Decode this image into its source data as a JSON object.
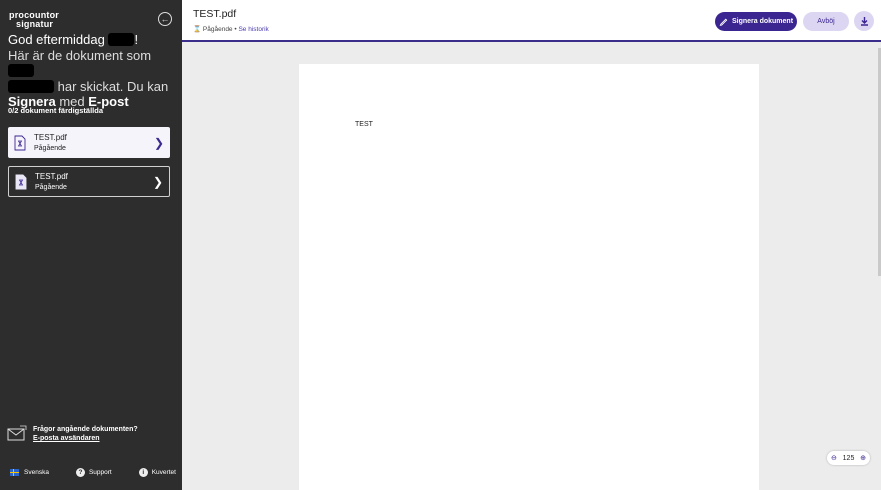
{
  "sidebar": {
    "logo_line1": "procountor",
    "logo_line2": "signatur",
    "greeting_prefix": "God eftermiddag",
    "greeting_end": "!",
    "intro_part1": "Här är de dokument som",
    "intro_part2": "har skickat. Du kan",
    "sign_word": "Signera",
    "with_word": "med",
    "method": "E-post",
    "progress": "0/2 dokument färdigställda",
    "documents": [
      {
        "name": "TEST.pdf",
        "status": "Pågående"
      },
      {
        "name": "TEST.pdf",
        "status": "Pågående"
      }
    ],
    "help_question": "Frågor angående dokumenten?",
    "help_link": "E-posta avsändaren",
    "footer": {
      "language": "Svenska",
      "support": "Support",
      "envelope": "Kuvertet"
    }
  },
  "header": {
    "title": "TEST.pdf",
    "status": "Pågående",
    "separator": "•",
    "history_link": "Se historik",
    "sign_button": "Signera dokument",
    "decline_button": "Avböj"
  },
  "document": {
    "text": "TEST"
  },
  "zoom": {
    "value": "125"
  },
  "colors": {
    "primary": "#3b2591",
    "secondary": "#dcd6f2",
    "sidebar": "#2d2d2d"
  }
}
